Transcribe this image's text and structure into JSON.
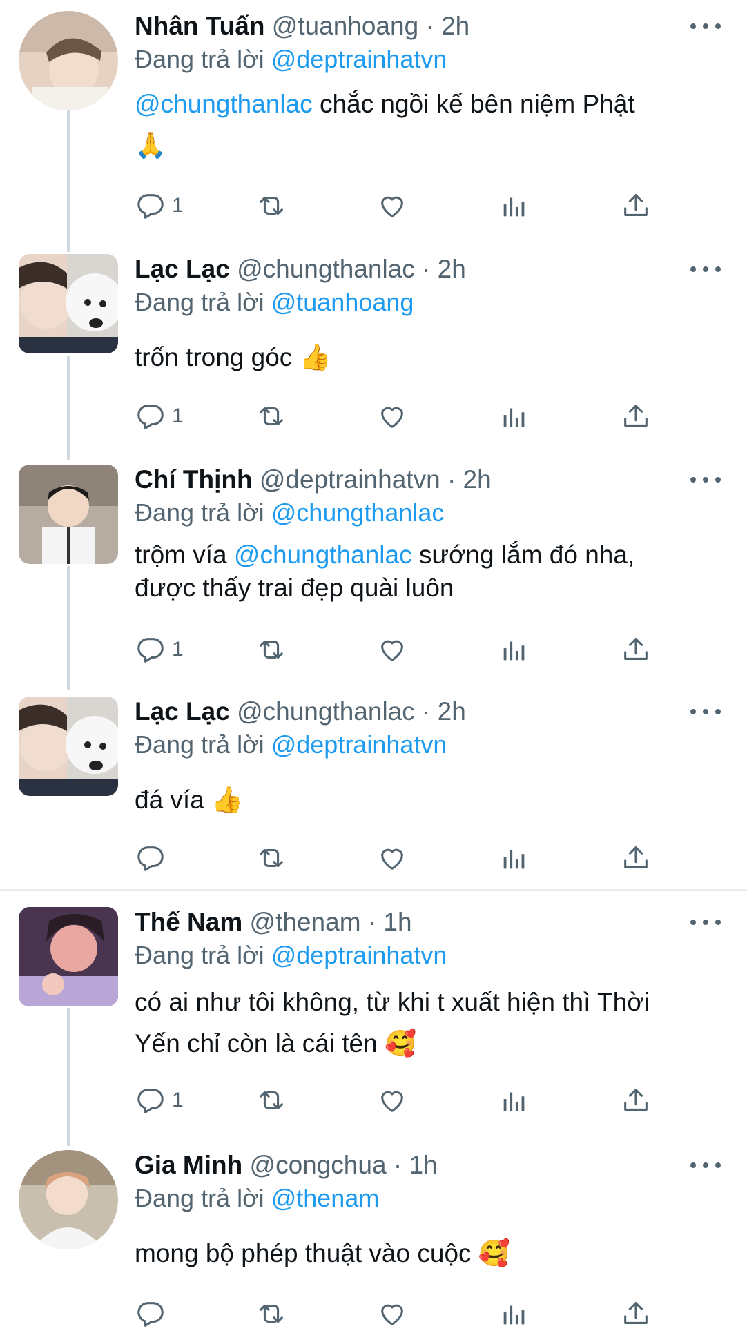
{
  "labels": {
    "replying_prefix": "Đang trả lời",
    "dot": "·"
  },
  "colors": {
    "link": "#1d9bf0",
    "muted": "#536471",
    "text": "#0f1419"
  },
  "tweets": [
    {
      "name": "Nhân Tuấn",
      "handle": "@tuanhoang",
      "time": "2h",
      "reply_to": "@deptrainhatvn",
      "line1_mention": "@chungthanlac",
      "line1_text": " chắc ngồi kế bên niệm Phật",
      "line2": "🙏",
      "reply_count": "1"
    },
    {
      "name": "Lạc Lạc",
      "handle": "@chungthanlac",
      "time": "2h",
      "reply_to": "@tuanhoang",
      "text": "trốn trong góc ",
      "emoji": "👍",
      "reply_count": "1"
    },
    {
      "name": "Chí Thịnh",
      "handle": "@deptrainhatvn",
      "time": "2h",
      "reply_to": "@chungthanlac",
      "line1_pre": "trộm vía ",
      "line1_mention": "@chungthanlac",
      "line1_post": " sướng lắm đó nha,",
      "line2": "được thấy trai đẹp quài luôn",
      "reply_count": "1"
    },
    {
      "name": "Lạc Lạc",
      "handle": "@chungthanlac",
      "time": "2h",
      "reply_to": "@deptrainhatvn",
      "text": "đá vía ",
      "emoji": "👍",
      "reply_count": ""
    },
    {
      "name": "Thế Nam",
      "handle": "@thenam",
      "time": "1h",
      "reply_to": "@deptrainhatvn",
      "line1": "có ai như tôi không, từ khi t xuất hiện thì Thời",
      "line2": "Yến chỉ còn là cái tên ",
      "emoji": "🥰",
      "reply_count": "1"
    },
    {
      "name": "Gia Minh",
      "handle": "@congchua",
      "time": "1h",
      "reply_to": "@thenam",
      "text": "mong bộ phép thuật vào cuộc ",
      "emoji": "🥰",
      "reply_count": ""
    }
  ]
}
